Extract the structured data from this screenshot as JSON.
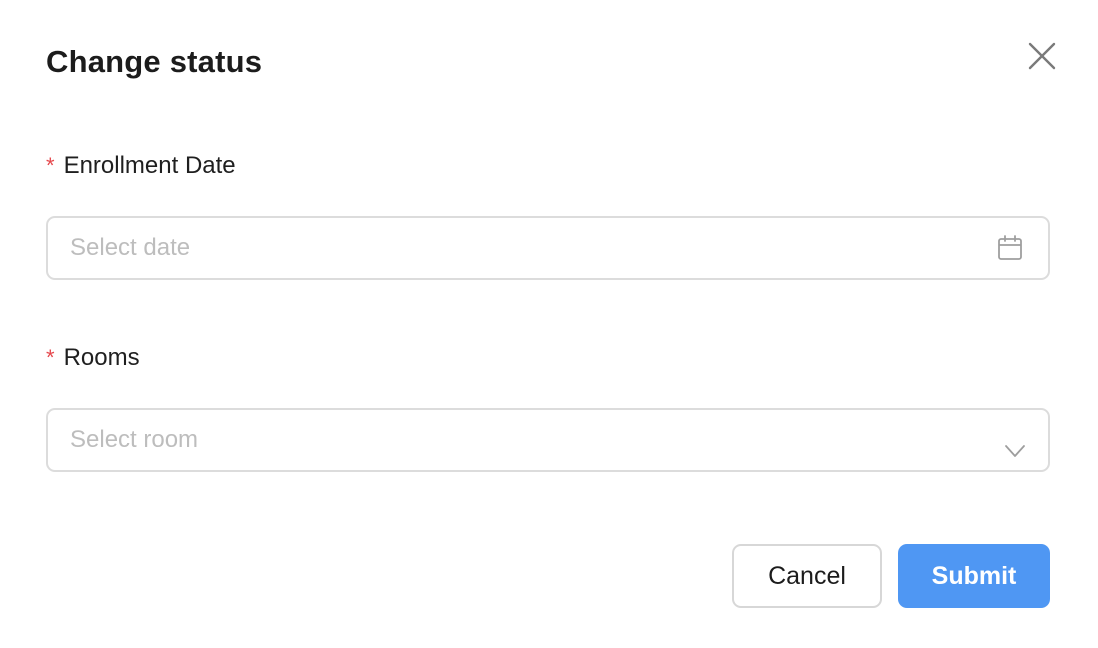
{
  "dialog": {
    "title": "Change status",
    "close_icon": "close-icon"
  },
  "fields": {
    "enrollment_date": {
      "required_mark": "*",
      "label": "Enrollment Date",
      "placeholder": "Select date",
      "icon": "calendar-icon"
    },
    "rooms": {
      "required_mark": "*",
      "label": "Rooms",
      "placeholder": "Select room",
      "icon": "chevron-down-icon"
    }
  },
  "actions": {
    "cancel_label": "Cancel",
    "submit_label": "Submit"
  },
  "colors": {
    "required": "#e5484d",
    "primary": "#4f97f3",
    "border": "#dcdcdc",
    "placeholder": "#bdbdbd"
  }
}
